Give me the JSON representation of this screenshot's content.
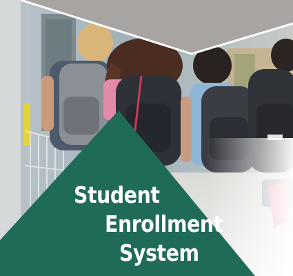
{
  "banner": {
    "title_lines": [
      "Student",
      "Enrollment",
      "System"
    ]
  },
  "colors": {
    "accent_green": "#1f6b58",
    "top_band": "#a8a4a1",
    "title_text": "#ffffff"
  },
  "image": {
    "subject": "photo-children-with-backpacks"
  }
}
